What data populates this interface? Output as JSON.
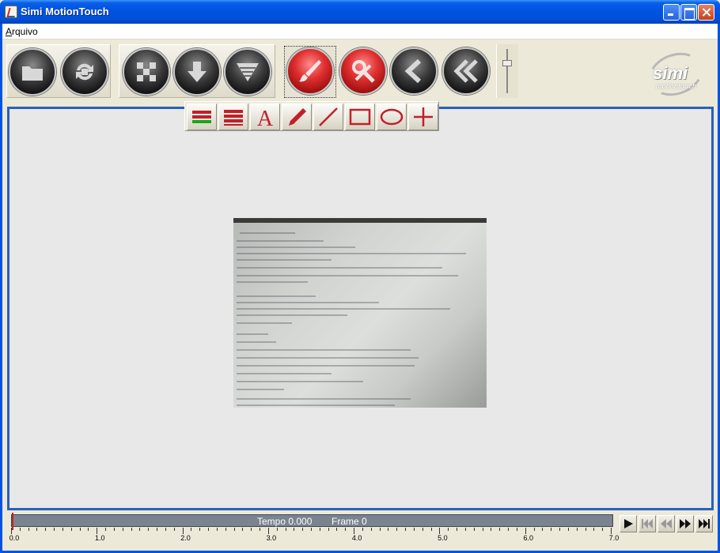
{
  "window": {
    "title": "Simi MotionTouch"
  },
  "menu": {
    "items": [
      {
        "label": "Arquivo",
        "accel": "A",
        "rest": "rquivo"
      }
    ]
  },
  "toolbar": {
    "buttons": [
      {
        "name": "open-folder",
        "icon": "folder-icon"
      },
      {
        "name": "convert",
        "icon": "convert-icon"
      },
      {
        "name": "grid-view",
        "icon": "checker-icon"
      },
      {
        "name": "download",
        "icon": "arrow-down-icon"
      },
      {
        "name": "filter",
        "icon": "funnel-icon"
      },
      {
        "name": "draw-mode",
        "icon": "brush-icon"
      },
      {
        "name": "erase",
        "icon": "erase-icon"
      },
      {
        "name": "previous",
        "icon": "chevron-left-icon"
      },
      {
        "name": "rewind",
        "icon": "double-chevron-left-icon"
      }
    ]
  },
  "logo": {
    "word": "simi",
    "sub": "motiontouch"
  },
  "draw_tools": [
    "color-lines",
    "line-weight",
    "text",
    "pencil",
    "line",
    "rectangle",
    "ellipse",
    "crosshair"
  ],
  "draw_text_glyph": "A",
  "timeline": {
    "tempo_label": "Tempo 0.000",
    "frame_label": "Frame 0"
  },
  "ruler": {
    "labels": [
      "0.0",
      "1.0",
      "2.0",
      "3.0",
      "4.0",
      "5.0",
      "6.0",
      "7.0"
    ]
  },
  "playback": [
    "play",
    "skip-back",
    "rewind",
    "fast-forward",
    "skip-end"
  ],
  "colors": {
    "accent_blue": "#2a5fbd",
    "draw_red": "#c0202a"
  }
}
